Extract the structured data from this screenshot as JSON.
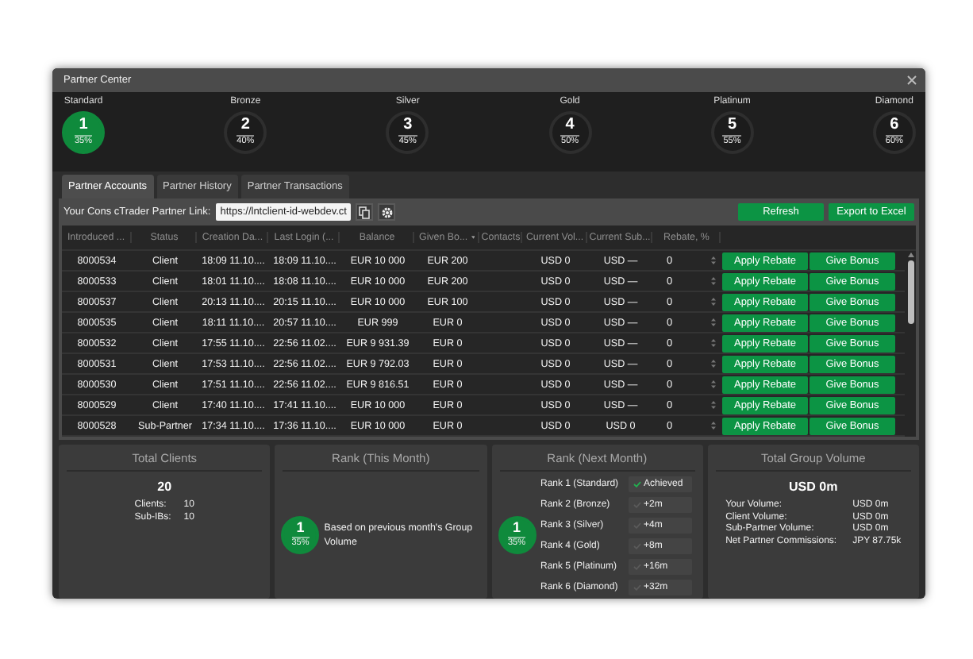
{
  "window": {
    "title": "Partner Center"
  },
  "ranks": [
    {
      "name": "Standard",
      "number": "1",
      "percent": "35%",
      "selected": true
    },
    {
      "name": "Bronze",
      "number": "2",
      "percent": "40%",
      "selected": false
    },
    {
      "name": "Silver",
      "number": "3",
      "percent": "45%",
      "selected": false
    },
    {
      "name": "Gold",
      "number": "4",
      "percent": "50%",
      "selected": false
    },
    {
      "name": "Platinum",
      "number": "5",
      "percent": "55%",
      "selected": false
    },
    {
      "name": "Diamond",
      "number": "6",
      "percent": "60%",
      "selected": false
    }
  ],
  "tabs": [
    {
      "label": "Partner Accounts",
      "selected": true
    },
    {
      "label": "Partner History",
      "selected": false
    },
    {
      "label": "Partner Transactions",
      "selected": false
    }
  ],
  "partner_link": {
    "label": "Your Cons cTrader Partner Link:",
    "value": "https://lntclient-id-webdev.ct"
  },
  "toolbar_buttons": [
    "Refresh",
    "Export to Excel"
  ],
  "table": {
    "columns": [
      "Introduced ...",
      "Status",
      "Creation Da...",
      "Last Login (...",
      "Balance",
      "Given Bo...",
      "Contacts",
      "Current Vol...",
      "Current Sub...",
      "Rebate, %"
    ],
    "rows": [
      {
        "id": "8000534",
        "status": "Client",
        "created": "18:09 11.10....",
        "last_login": "18:09 11.10....",
        "balance": "EUR 10 000",
        "bonus": "EUR 200",
        "current_volume": "USD 0",
        "current_sub": "USD —",
        "rebate": "0",
        "apply": "Apply Rebate",
        "give": "Give Bonus"
      },
      {
        "id": "8000533",
        "status": "Client",
        "created": "18:01 11.10....",
        "last_login": "18:08 11.10....",
        "balance": "EUR 10 000",
        "bonus": "EUR 200",
        "current_volume": "USD 0",
        "current_sub": "USD —",
        "rebate": "0",
        "apply": "Apply Rebate",
        "give": "Give Bonus"
      },
      {
        "id": "8000537",
        "status": "Client",
        "created": "20:13 11.10....",
        "last_login": "20:15 11.10....",
        "balance": "EUR 10 000",
        "bonus": "EUR 100",
        "current_volume": "USD 0",
        "current_sub": "USD —",
        "rebate": "0",
        "apply": "Apply Rebate",
        "give": "Give Bonus"
      },
      {
        "id": "8000535",
        "status": "Client",
        "created": "18:11 11.10....",
        "last_login": "20:57 11.10....",
        "balance": "EUR 999",
        "bonus": "EUR 0",
        "current_volume": "USD 0",
        "current_sub": "USD —",
        "rebate": "0",
        "apply": "Apply Rebate",
        "give": "Give Bonus"
      },
      {
        "id": "8000532",
        "status": "Client",
        "created": "17:55 11.10....",
        "last_login": "22:56 11.02....",
        "balance": "EUR 9 931.39",
        "bonus": "EUR 0",
        "current_volume": "USD 0",
        "current_sub": "USD —",
        "rebate": "0",
        "apply": "Apply Rebate",
        "give": "Give Bonus"
      },
      {
        "id": "8000531",
        "status": "Client",
        "created": "17:53 11.10....",
        "last_login": "22:56 11.02....",
        "balance": "EUR 9 792.03",
        "bonus": "EUR 0",
        "current_volume": "USD 0",
        "current_sub": "USD —",
        "rebate": "0",
        "apply": "Apply Rebate",
        "give": "Give Bonus"
      },
      {
        "id": "8000530",
        "status": "Client",
        "created": "17:51 11.10....",
        "last_login": "22:56 11.02....",
        "balance": "EUR 9 816.51",
        "bonus": "EUR 0",
        "current_volume": "USD 0",
        "current_sub": "USD —",
        "rebate": "0",
        "apply": "Apply Rebate",
        "give": "Give Bonus"
      },
      {
        "id": "8000529",
        "status": "Client",
        "created": "17:40 11.10....",
        "last_login": "17:41 11.10....",
        "balance": "EUR 10 000",
        "bonus": "EUR 0",
        "current_volume": "USD 0",
        "current_sub": "USD —",
        "rebate": "0",
        "apply": "Apply Rebate",
        "give": "Give Bonus"
      },
      {
        "id": "8000528",
        "status": "Sub-Partner",
        "created": "17:34 11.10....",
        "last_login": "17:36 11.10....",
        "balance": "EUR 10 000",
        "bonus": "EUR 0",
        "current_volume": "USD 0",
        "current_sub": "USD 0",
        "rebate": "0",
        "apply": "Apply Rebate",
        "give": "Give Bonus"
      }
    ]
  },
  "total_clients": {
    "title": "Total Clients",
    "total": "20",
    "stats": [
      {
        "label": "Clients:",
        "value": "10"
      },
      {
        "label": "Sub-IBs:",
        "value": "10"
      }
    ]
  },
  "rank_this_month": {
    "title": "Rank (This Month)",
    "number": "1",
    "percent": "35%",
    "note": "Based on previous month's Group Volume"
  },
  "rank_next_month": {
    "title": "Rank (Next Month)",
    "number": "1",
    "percent": "35%",
    "steps": [
      {
        "label": "Rank 1 (Standard)",
        "value": "Achieved",
        "achieved": true
      },
      {
        "label": "Rank 2 (Bronze)",
        "value": "+2m",
        "achieved": false
      },
      {
        "label": "Rank 3 (Silver)",
        "value": "+4m",
        "achieved": false
      },
      {
        "label": "Rank 4 (Gold)",
        "value": "+8m",
        "achieved": false
      },
      {
        "label": "Rank 5 (Platinum)",
        "value": "+16m",
        "achieved": false
      },
      {
        "label": "Rank 6 (Diamond)",
        "value": "+32m",
        "achieved": false
      }
    ]
  },
  "total_group_volume": {
    "title": "Total Group Volume",
    "total": "USD 0m",
    "stats": [
      {
        "label": "Your Volume:",
        "value": "USD 0m"
      },
      {
        "label": "Client Volume:",
        "value": "USD 0m"
      },
      {
        "label": "Sub-Partner Volume:",
        "value": "USD 0m"
      },
      {
        "label": "Net Partner Commissions:",
        "value": "JPY 87.75k"
      }
    ]
  }
}
